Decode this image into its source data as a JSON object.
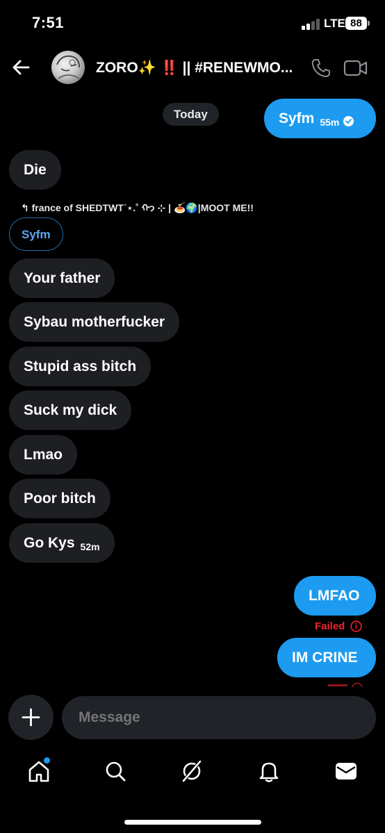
{
  "status_bar": {
    "time": "7:51",
    "network": "LTE",
    "battery": "88"
  },
  "header": {
    "title": "ZORO✨ ‼️ || #RENEWMO...",
    "back_icon": "arrow-left-icon",
    "call_icon": "phone-icon",
    "video_icon": "video-camera-icon"
  },
  "date_chip": "Today",
  "messages": {
    "first_out": {
      "text": "Syfm",
      "time": "55m"
    },
    "die": "Die",
    "reply_context": "↰ france of SHEDTWT˙⋆.˚ ᡣ𐭩 ⊹ | 🍝🌍|MOOT ME!!",
    "quoted": "Syfm",
    "m1": "Your father",
    "m2": "Sybau motherfucker",
    "m3": "Stupid ass bitch",
    "m4": "Suck my dick",
    "m5": "Lmao",
    "m6": "Poor bitch",
    "m7": {
      "text": "Go Kys",
      "time": "52m"
    },
    "out2": "LMFAO",
    "out2_status": "Failed",
    "out3": "IM CRINE"
  },
  "composer": {
    "placeholder": "Message"
  },
  "nav": {
    "items": [
      "home-icon",
      "search-icon",
      "grok-icon",
      "bell-icon",
      "mail-icon"
    ]
  },
  "colors": {
    "accent": "#1d9bf0",
    "bubble_in": "#1e1f23",
    "error": "#f4212e"
  }
}
